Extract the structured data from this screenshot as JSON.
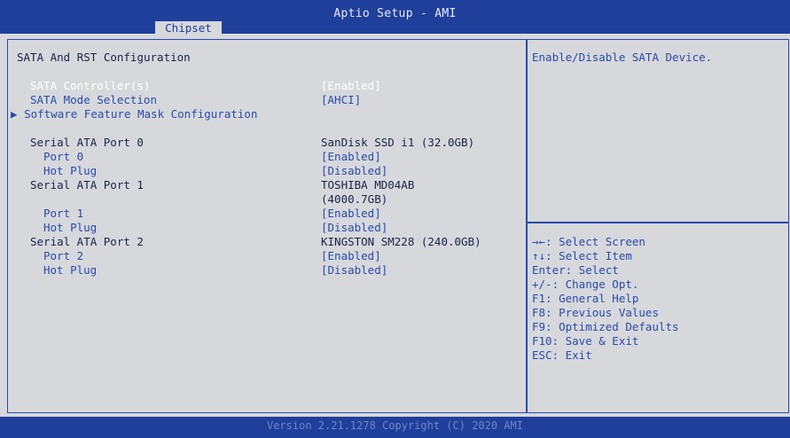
{
  "app": {
    "title": "Aptio Setup - AMI"
  },
  "tabs": {
    "active": "Chipset"
  },
  "section_title": "SATA And RST Configuration",
  "settings": {
    "sata_controller": {
      "label": "SATA Controller(s)",
      "value": "[Enabled]"
    },
    "sata_mode": {
      "label": "SATA Mode Selection",
      "value": "[AHCI]"
    },
    "software_mask": {
      "marker": "▶",
      "label": "Software Feature Mask Configuration"
    },
    "port0": {
      "label": "Serial ATA Port 0",
      "device": "SanDisk SSD i1 (32.0GB)",
      "port_label": "Port 0",
      "port_value": "[Enabled]",
      "hotplug_label": "Hot Plug",
      "hotplug_value": "[Disabled]"
    },
    "port1": {
      "label": "Serial ATA Port 1",
      "device_line1": "TOSHIBA MD04AB",
      "device_line2": "(4000.7GB)",
      "port_label": "Port 1",
      "port_value": "[Enabled]",
      "hotplug_label": "Hot Plug",
      "hotplug_value": "[Disabled]"
    },
    "port2": {
      "label": "Serial ATA Port 2",
      "device": "KINGSTON SM228 (240.0GB)",
      "port_label": "Port 2",
      "port_value": "[Enabled]",
      "hotplug_label": "Hot Plug",
      "hotplug_value": "[Disabled]"
    }
  },
  "help": {
    "description": "Enable/Disable SATA Device."
  },
  "keys": [
    "→←: Select Screen",
    "↑↓: Select Item",
    "Enter: Select",
    "+/-: Change Opt.",
    "F1: General Help",
    "F8: Previous Values",
    "F9: Optimized Defaults",
    "F10: Save & Exit",
    "ESC: Exit"
  ],
  "footer": {
    "text": "Version 2.21.1278 Copyright (C) 2020 AMI"
  },
  "colors": {
    "bar": "#1f3f9a",
    "background": "#d6d8dc",
    "accent": "#2a4aa8"
  }
}
